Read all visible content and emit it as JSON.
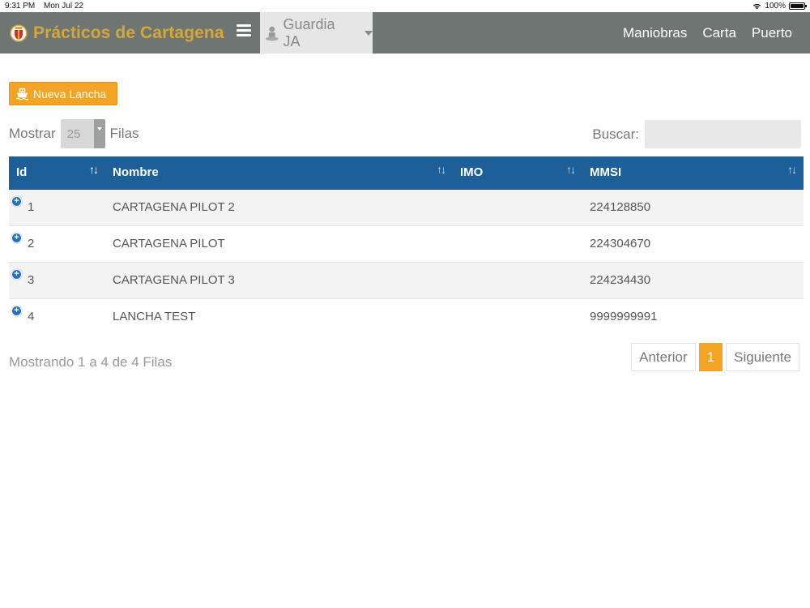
{
  "status_bar": {
    "time": "9:31 PM",
    "date": "Mon Jul 22",
    "battery": "100%"
  },
  "navbar": {
    "brand": "Prácticos de Cartagena",
    "user": "Guardia JA",
    "links": [
      "Maniobras",
      "Carta",
      "Puerto"
    ]
  },
  "actions": {
    "new_button": "Nueva Lancha"
  },
  "length": {
    "prefix": "Mostrar",
    "value": "25",
    "suffix": "Filas"
  },
  "search": {
    "label": "Buscar:",
    "value": ""
  },
  "table": {
    "headers": [
      "Id",
      "Nombre",
      "IMO",
      "MMSI"
    ],
    "rows": [
      {
        "id": "1",
        "nombre": "CARTAGENA PILOT 2",
        "imo": "",
        "mmsi": "224128850"
      },
      {
        "id": "2",
        "nombre": "CARTAGENA PILOT",
        "imo": "",
        "mmsi": "224304670"
      },
      {
        "id": "3",
        "nombre": "CARTAGENA PILOT 3",
        "imo": "",
        "mmsi": "224234430"
      },
      {
        "id": "4",
        "nombre": "LANCHA TEST",
        "imo": "",
        "mmsi": "9999999991"
      }
    ]
  },
  "footer": {
    "info": "Mostrando 1 a 4 de 4 Filas",
    "prev": "Anterior",
    "page": "1",
    "next": "Siguiente"
  },
  "colors": {
    "navbar": "#6f7572",
    "brand": "#d4a73a",
    "accent": "#f4a424",
    "table_header": "#1c5f99"
  }
}
